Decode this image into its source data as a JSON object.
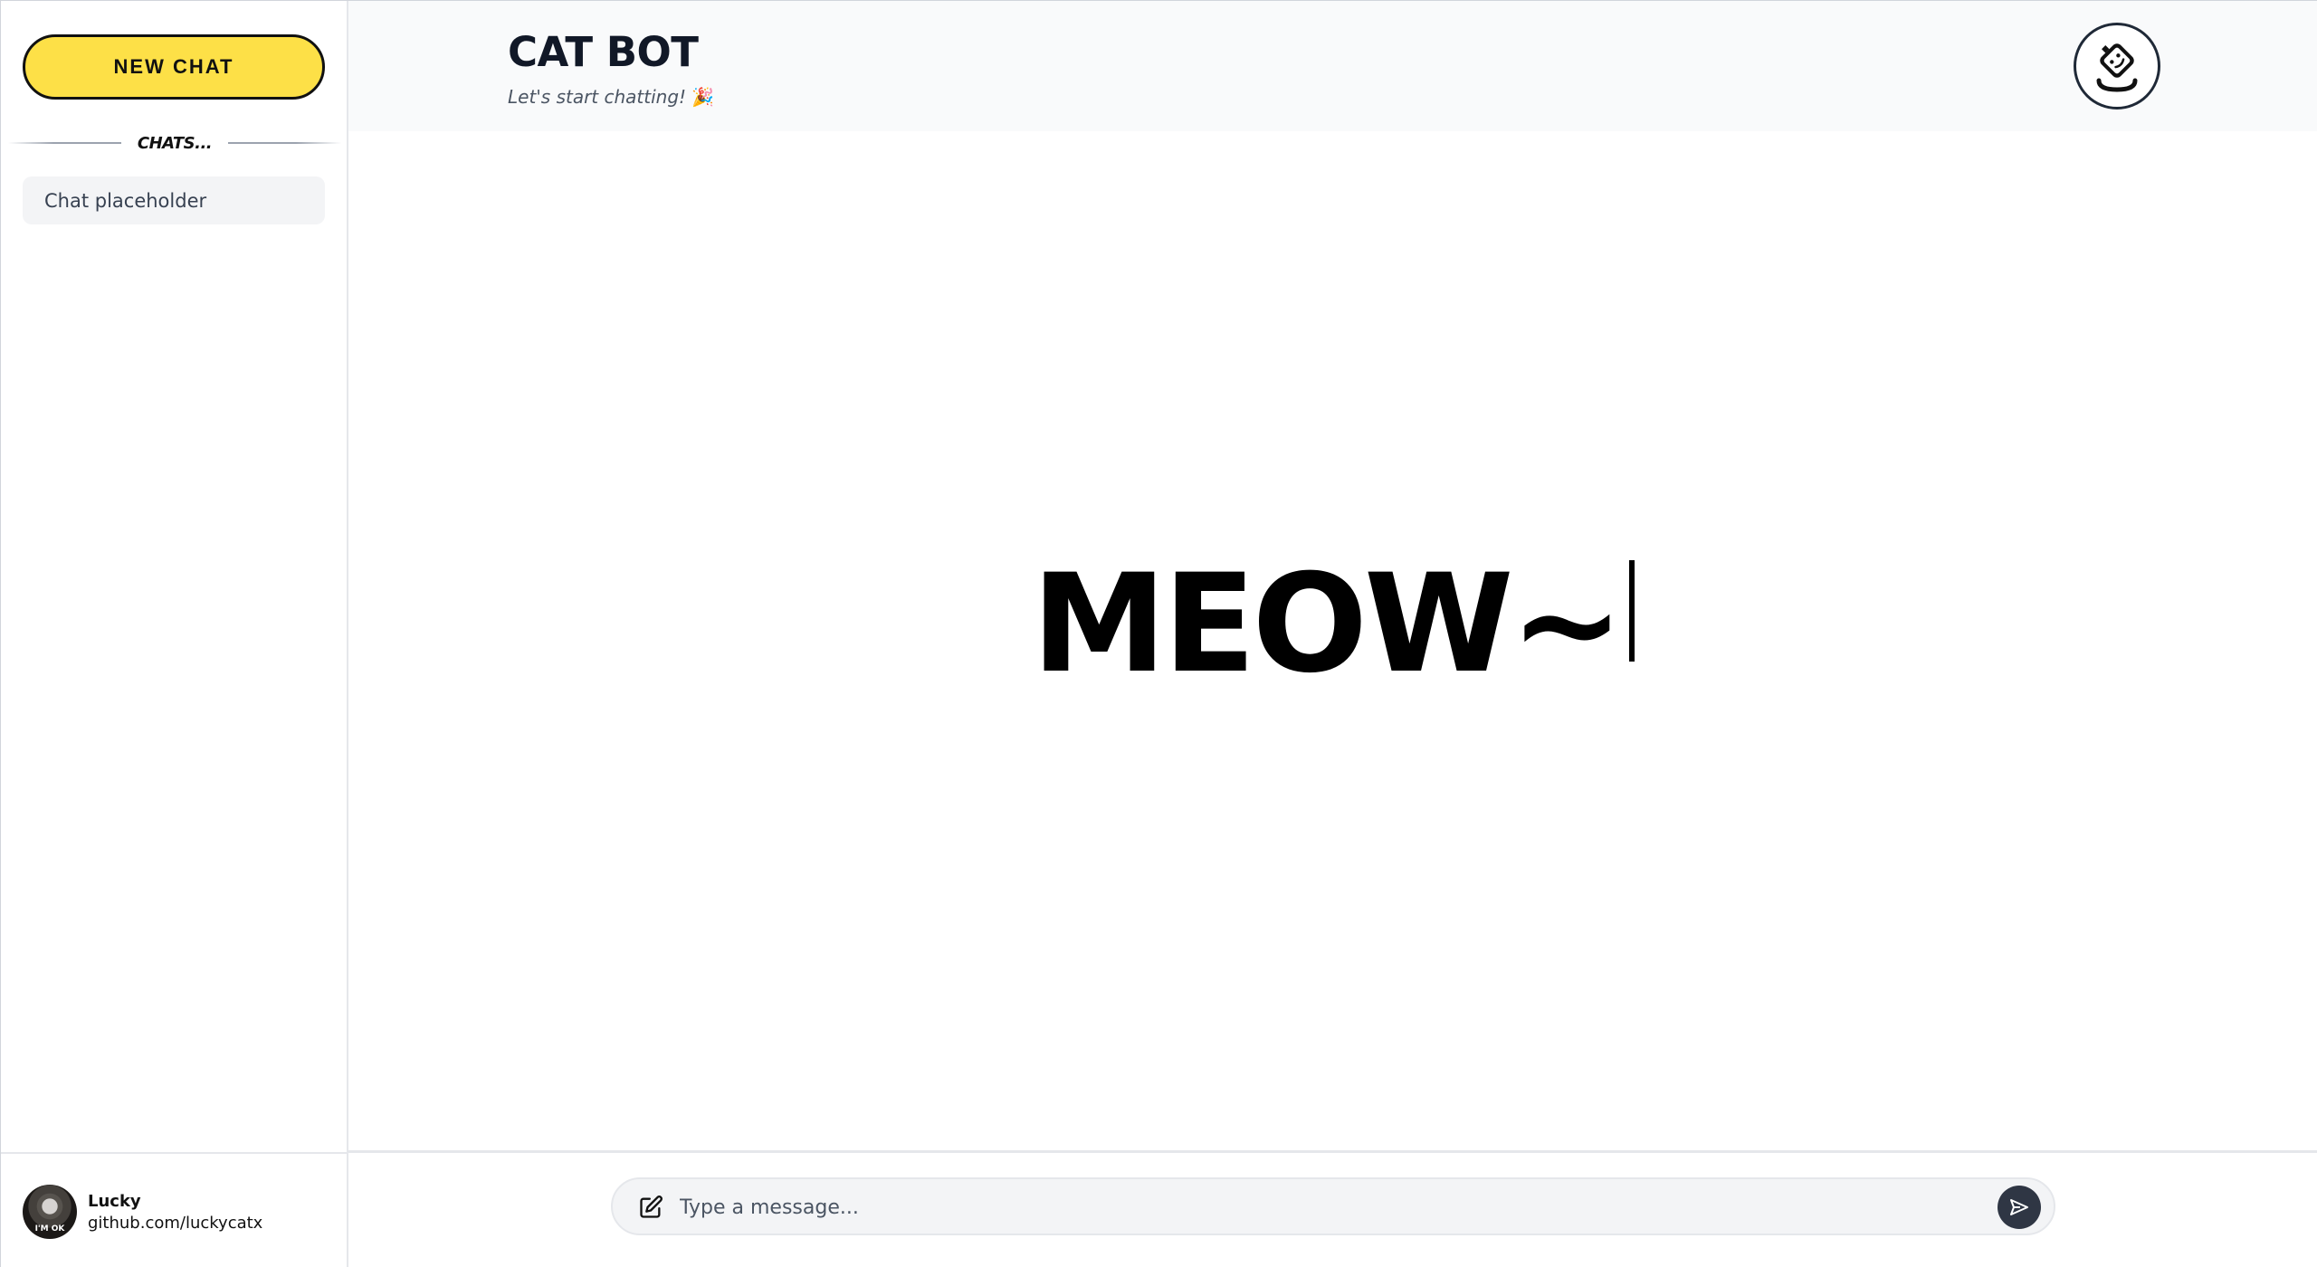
{
  "sidebar": {
    "new_chat_label": "NEW CHAT",
    "chats_heading": "CHATS...",
    "chat_items": [
      {
        "label": "Chat placeholder"
      }
    ],
    "user": {
      "name": "Lucky",
      "link": "github.com/luckycatx",
      "avatar_caption": "I'M OK"
    }
  },
  "header": {
    "title": "CAT BOT",
    "subtitle": "Let's start chatting!",
    "subtitle_emoji": "🎉",
    "bot_icon": "robot-bot-icon"
  },
  "main": {
    "hero_text": "MEOW~"
  },
  "composer": {
    "placeholder": "Type a message...",
    "edit_icon": "edit-icon",
    "send_icon": "send-icon"
  },
  "colors": {
    "accent_yellow": "#fde047",
    "dark": "#111111",
    "send_button": "#2f3644",
    "header_bg": "#f9fafb"
  }
}
